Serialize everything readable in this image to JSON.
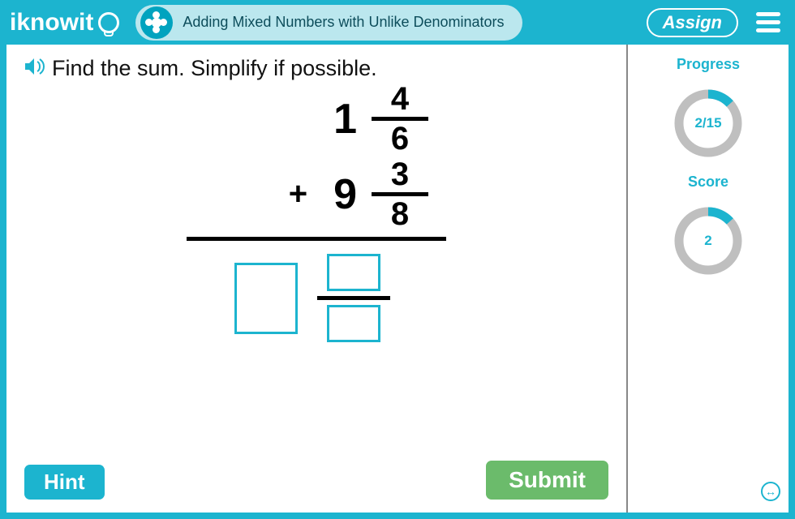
{
  "header": {
    "logo_text": "iknowit",
    "topic_title": "Adding Mixed Numbers with Unlike Denominators",
    "assign_label": "Assign"
  },
  "prompt": "Find the sum. Simplify if possible.",
  "problem": {
    "operator": "+",
    "term1": {
      "whole": "1",
      "numerator": "4",
      "denominator": "6"
    },
    "term2": {
      "whole": "9",
      "numerator": "3",
      "denominator": "8"
    }
  },
  "buttons": {
    "hint": "Hint",
    "submit": "Submit"
  },
  "sidebar": {
    "progress_label": "Progress",
    "progress_text": "2/15",
    "progress_current": 2,
    "progress_total": 15,
    "score_label": "Score",
    "score_text": "2",
    "score_value": 2
  },
  "colors": {
    "brand": "#1cb4cf",
    "pill": "#bbe7ee",
    "submit": "#6bbb6b",
    "ring_track": "#bfbfbf"
  }
}
